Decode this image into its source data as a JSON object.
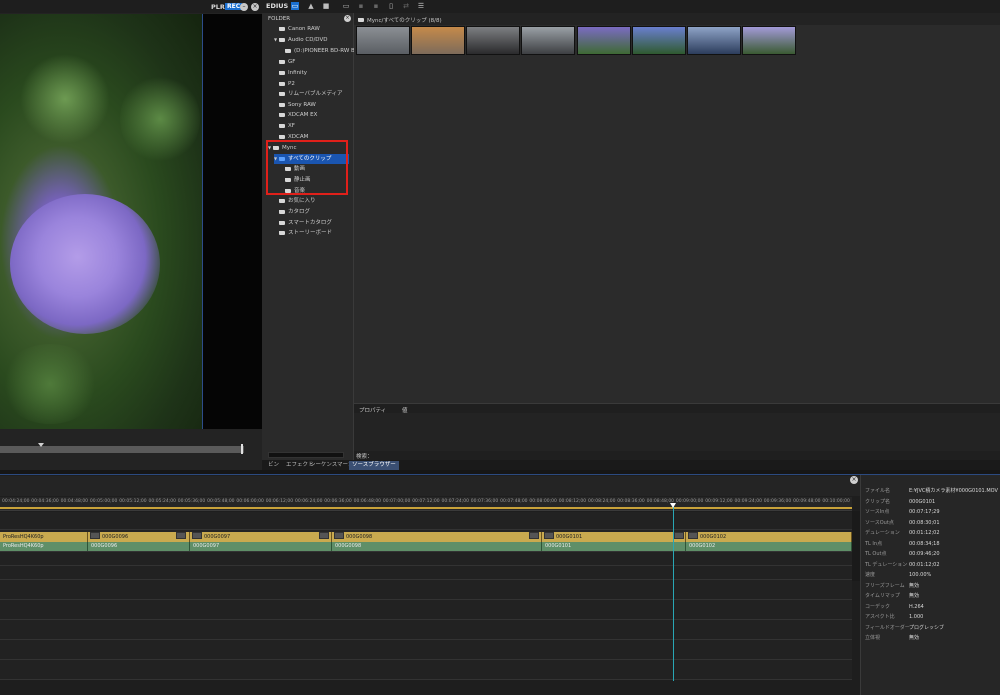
{
  "player": {
    "plr_label": "PLR",
    "rec_label": "REC"
  },
  "app": {
    "name": "EDIUS"
  },
  "folder_panel": {
    "header": "FOLDER",
    "items": [
      {
        "label": "Canon RAW",
        "level": 1,
        "expanded": false
      },
      {
        "label": "Audio CD/DVD",
        "level": 1,
        "expanded": true
      },
      {
        "label": "(D:)PIONEER BD-RW   BDR",
        "level": 2,
        "expanded": false
      },
      {
        "label": "GF",
        "level": 1,
        "expanded": false
      },
      {
        "label": "Infinity",
        "level": 1,
        "expanded": false
      },
      {
        "label": "P2",
        "level": 1,
        "expanded": false
      },
      {
        "label": "リムーバブルメディア",
        "level": 1,
        "expanded": false
      },
      {
        "label": "Sony RAW",
        "level": 1,
        "expanded": false
      },
      {
        "label": "XDCAM EX",
        "level": 1,
        "expanded": false
      },
      {
        "label": "XF",
        "level": 1,
        "expanded": false
      },
      {
        "label": "XDCAM",
        "level": 1,
        "expanded": false
      },
      {
        "label": "Mync",
        "level": 0,
        "expanded": true
      },
      {
        "label": "すべてのクリップ",
        "level": 1,
        "expanded": true,
        "selected": true
      },
      {
        "label": "動画",
        "level": 2,
        "expanded": false
      },
      {
        "label": "静止画",
        "level": 2,
        "expanded": false
      },
      {
        "label": "音楽",
        "level": 2,
        "expanded": false
      },
      {
        "label": "お気に入り",
        "level": 1,
        "expanded": false
      },
      {
        "label": "カタログ",
        "level": 1,
        "expanded": false
      },
      {
        "label": "スマートカタログ",
        "level": 1,
        "expanded": false
      },
      {
        "label": "ストーリーボード",
        "level": 1,
        "expanded": false
      }
    ]
  },
  "browser": {
    "path": "Mync/すべてのクリップ (8/8)",
    "thumbnails": [
      {
        "name": "thumb-1",
        "color1": "#8b8f94",
        "color2": "#5a5e63"
      },
      {
        "name": "thumb-2",
        "color1": "#c58a4a",
        "color2": "#7d6b5a"
      },
      {
        "name": "thumb-3",
        "color1": "#7d7f82",
        "color2": "#2a2a2c"
      },
      {
        "name": "thumb-4",
        "color1": "#9aa0a6",
        "color2": "#3d3f42"
      },
      {
        "name": "thumb-5",
        "color1": "#7b6bc2",
        "color2": "#3e6a34"
      },
      {
        "name": "thumb-6",
        "color1": "#6a7fcf",
        "color2": "#2f5a2f"
      },
      {
        "name": "thumb-7",
        "color1": "#8ea3c7",
        "color2": "#2c3d5c"
      },
      {
        "name": "thumb-8",
        "color1": "#a39ad8",
        "color2": "#3a5a32"
      }
    ],
    "props_col1": "プロパティ",
    "props_col2": "値",
    "search_label": "検索："
  },
  "tabs": [
    {
      "label": "ビン",
      "active": false
    },
    {
      "label": "エフェクト",
      "active": false
    },
    {
      "label": "シーケンスマーカー",
      "active": false
    },
    {
      "label": "ソースブラウザー",
      "active": true
    }
  ],
  "timeline": {
    "ruler_labels": [
      "00:04:24;00",
      "00:04:36;00",
      "00:04:48;00",
      "00:05:00;00",
      "00:05:12;00",
      "00:05:24;00",
      "00:05:36;00",
      "00:05:48;00",
      "00:06:00;00",
      "00:06:12;00",
      "00:06:24;00",
      "00:06:36;00",
      "00:06:48;00",
      "00:07:00;00",
      "00:07:12;00",
      "00:07:24;00",
      "00:07:36;00",
      "00:07:48;00",
      "00:08:00;00",
      "00:08:12;00",
      "00:08:24;00",
      "00:08:36;00",
      "00:08:48;00",
      "00:09:00;00",
      "00:09:12;00",
      "00:09:24;00",
      "00:09:36;00",
      "00:09:48;00",
      "00:10:00;00"
    ],
    "video_clips": [
      {
        "label": "ProResHQ4K60p"
      },
      {
        "label": "000G0096"
      },
      {
        "label": "000G0097"
      },
      {
        "label": "000G0098"
      },
      {
        "label": "000G0101"
      },
      {
        "label": "000G0102"
      }
    ],
    "audio_clips": [
      {
        "label": "ProResHQ4K60p"
      },
      {
        "label": "000G0096"
      },
      {
        "label": "000G0097"
      },
      {
        "label": "000G0098"
      },
      {
        "label": "000G0101"
      },
      {
        "label": "000G0102"
      }
    ]
  },
  "info_panel": {
    "rows": [
      {
        "k": "ファイル名",
        "v": "E:¥JVC積カメラ素材¥000G0101.MOV"
      },
      {
        "k": "クリップ名",
        "v": "000G0101"
      },
      {
        "k": "ソースIn点",
        "v": "00:07:17;29"
      },
      {
        "k": "ソースOut点",
        "v": "00:08:30;01"
      },
      {
        "k": "デュレーション",
        "v": "00:01:12;02"
      },
      {
        "k": "TL In点",
        "v": "00:08:34;18"
      },
      {
        "k": "TL Out点",
        "v": "00:09:46;20"
      },
      {
        "k": "TL デュレーション",
        "v": "00:01:12;02"
      },
      {
        "k": "速度",
        "v": "100.00%"
      },
      {
        "k": "フリーズフレーム",
        "v": "無効"
      },
      {
        "k": "タイムリマップ",
        "v": "無効"
      },
      {
        "k": "コーデック",
        "v": "H.264"
      },
      {
        "k": "アスペクト比",
        "v": "1.000"
      },
      {
        "k": "フィールドオーダー",
        "v": "プログレッシブ"
      },
      {
        "k": "立体視",
        "v": "無効"
      }
    ]
  }
}
